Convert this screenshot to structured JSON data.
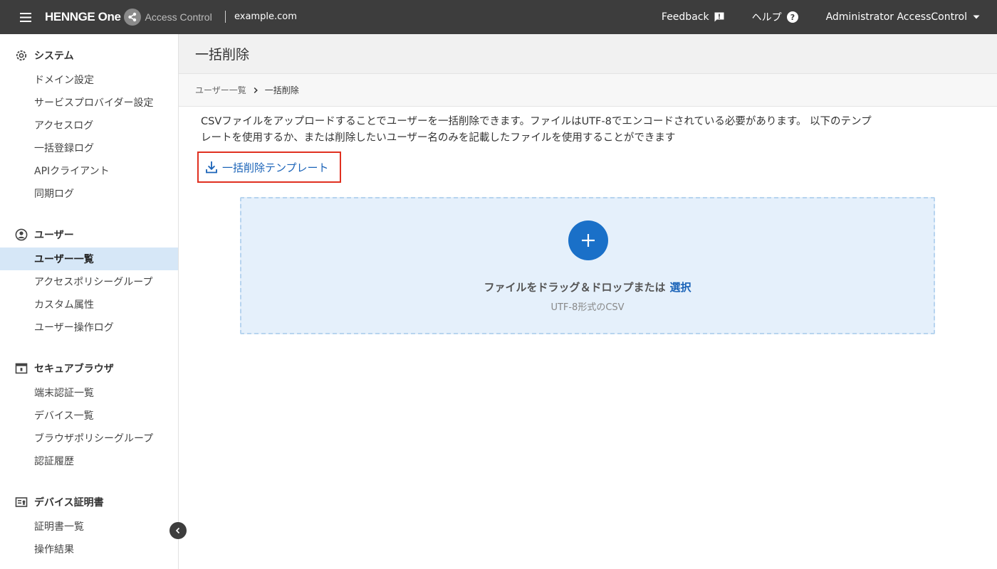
{
  "header": {
    "logo_text": "HENNGE One",
    "product": "Access Control",
    "tenant": "example.com",
    "feedback": "Feedback",
    "help": "ヘルプ",
    "user": "Administrator AccessControl",
    "colors": {
      "bar": "#3d3d3d",
      "accent": "#1a70c8"
    }
  },
  "sidebar": {
    "sections": [
      {
        "title": "システム",
        "icon": "gear-icon",
        "items": [
          "ドメイン設定",
          "サービスプロバイダー設定",
          "アクセスログ",
          "一括登録ログ",
          "APIクライアント",
          "同期ログ"
        ]
      },
      {
        "title": "ユーザー",
        "icon": "user-circle-icon",
        "items": [
          "ユーザー一覧",
          "アクセスポリシーグループ",
          "カスタム属性",
          "ユーザー操作ログ"
        ],
        "active_item": "ユーザー一覧"
      },
      {
        "title": "セキュアブラウザ",
        "icon": "browser-window-icon",
        "items": [
          "端末認証一覧",
          "デバイス一覧",
          "ブラウザポリシーグループ",
          "認証履歴"
        ]
      },
      {
        "title": "デバイス証明書",
        "icon": "certificate-card-icon",
        "items": [
          "証明書一覧",
          "操作結果"
        ]
      }
    ]
  },
  "page": {
    "title": "一括削除",
    "breadcrumb": {
      "parent": "ユーザー一覧",
      "current": "一括削除"
    },
    "description_line1": "CSVファイルをアップロードすることでユーザーを一括削除できます。ファイルはUTF-8でエンコードされている必要があります。 以下のテンプ",
    "description_line2": "レートを使用するか、または削除したいユーザー名のみを記載したファイルを使用することができます",
    "template_link": "一括削除テンプレート",
    "dropzone": {
      "main_text": "ファイルをドラッグ＆ドロップまたは",
      "select_link": "選択",
      "sub_text": "UTF-8形式のCSV"
    }
  }
}
